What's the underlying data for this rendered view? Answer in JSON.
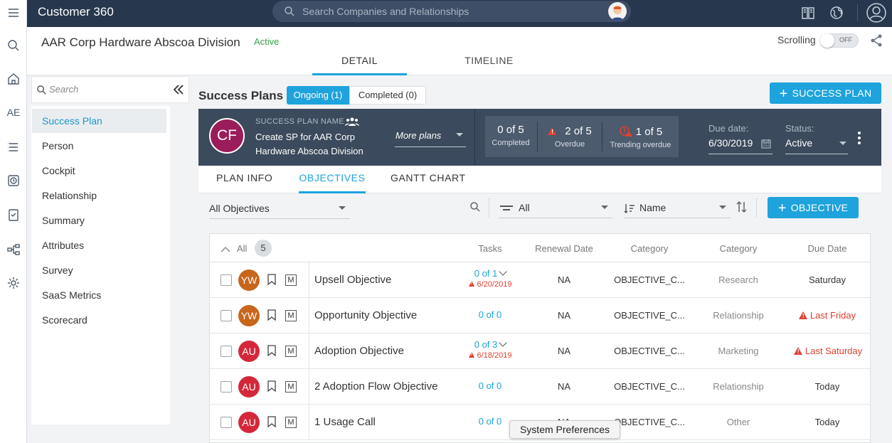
{
  "app": {
    "title": "Customer 360"
  },
  "rail": {
    "ae_label": "AE"
  },
  "search": {
    "placeholder": "Search Companies and Relationships"
  },
  "header": {
    "company_name": "AAR Corp Hardware Abscoa Division",
    "company_status": "Active",
    "tabs": [
      {
        "label": "DETAIL"
      },
      {
        "label": "TIMELINE"
      }
    ],
    "scrolling_label": "Scrolling",
    "scrolling_toggle": "OFF"
  },
  "leftnav": {
    "search_placeholder": "Search",
    "items": [
      {
        "label": "Success Plan"
      },
      {
        "label": "Person"
      },
      {
        "label": "Cockpit"
      },
      {
        "label": "Relationship"
      },
      {
        "label": "Summary"
      },
      {
        "label": "Attributes"
      },
      {
        "label": "Survey"
      },
      {
        "label": "SaaS Metrics"
      },
      {
        "label": "Scorecard"
      }
    ]
  },
  "success_plans": {
    "title": "Success Plans",
    "ongoing_label": "Ongoing (1)",
    "completed_label": "Completed (0)",
    "add_button": "SUCCESS PLAN",
    "plan": {
      "avatar": "CF",
      "name_label": "SUCCESS PLAN NAME",
      "name": "Create SP for AAR Corp Hardware Abscoa Division",
      "more_plans": "More plans",
      "stats": {
        "completed_value": "0 of 5",
        "completed_label": "Completed",
        "overdue_value": "2 of 5",
        "overdue_label": "Overdue",
        "trending_value": "1 of 5",
        "trending_label": "Trending overdue"
      },
      "due_label": "Due date:",
      "due_value": "6/30/2019",
      "status_label": "Status:",
      "status_value": "Active"
    },
    "subtabs": [
      {
        "label": "PLAN INFO"
      },
      {
        "label": "OBJECTIVES"
      },
      {
        "label": "GANTT CHART"
      }
    ]
  },
  "filters": {
    "objectives_select": "All Objectives",
    "filter_select": "All",
    "sort_select": "Name",
    "add_objective": "OBJECTIVE"
  },
  "table": {
    "header": {
      "all": "All",
      "count": "5",
      "tasks": "Tasks",
      "renewal_date": "Renewal Date",
      "category1": "Category",
      "category2": "Category",
      "due_date": "Due Date"
    },
    "rows": [
      {
        "avatar": "YW",
        "name": "Upsell Objective",
        "tasks": "0 of 1",
        "tasks_overdue": "6/20/2019",
        "renewal": "NA",
        "category1": "OBJECTIVE_C...",
        "category2": "Research",
        "due": "Saturday"
      },
      {
        "avatar": "YW",
        "name": "Opportunity Objective",
        "tasks": "0 of 0",
        "tasks_overdue": "",
        "renewal": "NA",
        "category1": "OBJECTIVE_C...",
        "category2": "Relationship",
        "due": "Last Friday"
      },
      {
        "avatar": "AU",
        "name": "Adoption Objective",
        "tasks": "0 of 3",
        "tasks_overdue": "6/18/2019",
        "renewal": "NA",
        "category1": "OBJECTIVE_C...",
        "category2": "Marketing",
        "due": "Last Saturday"
      },
      {
        "avatar": "AU",
        "name": "2 Adoption Flow Objective",
        "tasks": "0 of 0",
        "tasks_overdue": "",
        "renewal": "NA",
        "category1": "OBJECTIVE_C...",
        "category2": "Relationship",
        "due": "Today"
      },
      {
        "avatar": "AU",
        "name": "1 Usage Call",
        "tasks": "0 of 0",
        "tasks_overdue": "",
        "renewal": "NA",
        "category1": "OBJECTIVE_C...",
        "category2": "Other",
        "due": "Today"
      }
    ],
    "m_label": "M"
  },
  "tooltip": {
    "text": "System Preferences"
  },
  "colors": {
    "topbar": "#27374d",
    "accent": "#1ea3dc",
    "plan_card": "#3b4a5c",
    "avatar_yw": "#c8661b",
    "avatar_au": "#d4283a",
    "avatar_cf": "#9b1c5a",
    "overdue": "#e0402e",
    "active_status": "#39a44a"
  },
  "icons": [
    "hamburger-icon",
    "search-icon",
    "home-icon",
    "list-icon",
    "clock-icon",
    "clipboard-icon",
    "hierarchy-icon",
    "gear-icon",
    "book-icon",
    "globe-icon",
    "user-icon",
    "share-icon",
    "collapse-icon",
    "people-icon",
    "calendar-icon",
    "bookmark-icon",
    "sort-icon",
    "filter-icon"
  ]
}
